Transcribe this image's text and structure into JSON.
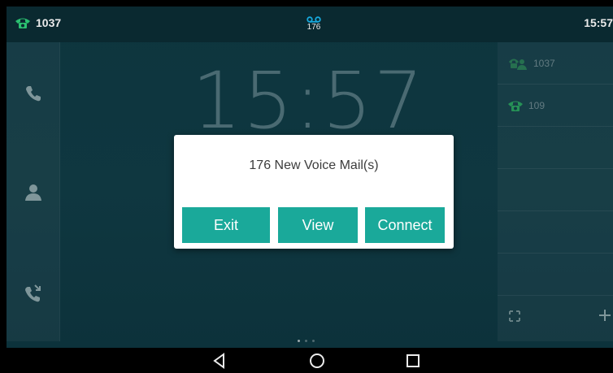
{
  "status_bar": {
    "account_number": "1037",
    "voicemail_count": "176",
    "time": "15:57"
  },
  "clock": {
    "time": "15:57"
  },
  "left_sidebar": {
    "items": [
      {
        "icon": "phone-icon"
      },
      {
        "icon": "contacts-icon"
      },
      {
        "icon": "call-history-icon"
      }
    ]
  },
  "line_panel": {
    "lines": [
      {
        "label": "1037",
        "icon": "account-phone-icon"
      },
      {
        "label": "109",
        "icon": "phone-handset-icon"
      }
    ],
    "actions": [
      {
        "icon": "fullscreen-icon"
      },
      {
        "icon": "plus-icon",
        "label": "+"
      }
    ]
  },
  "dialog": {
    "message": "176 New Voice Mail(s)",
    "buttons": {
      "exit": "Exit",
      "view": "View",
      "connect": "Connect"
    }
  },
  "navigation": {
    "buttons": [
      {
        "icon": "back-icon"
      },
      {
        "icon": "home-icon"
      },
      {
        "icon": "recents-icon"
      }
    ]
  },
  "colors": {
    "accent": "#1aa99a",
    "line_green": "#2fb36a",
    "background": "#0f3a44"
  }
}
